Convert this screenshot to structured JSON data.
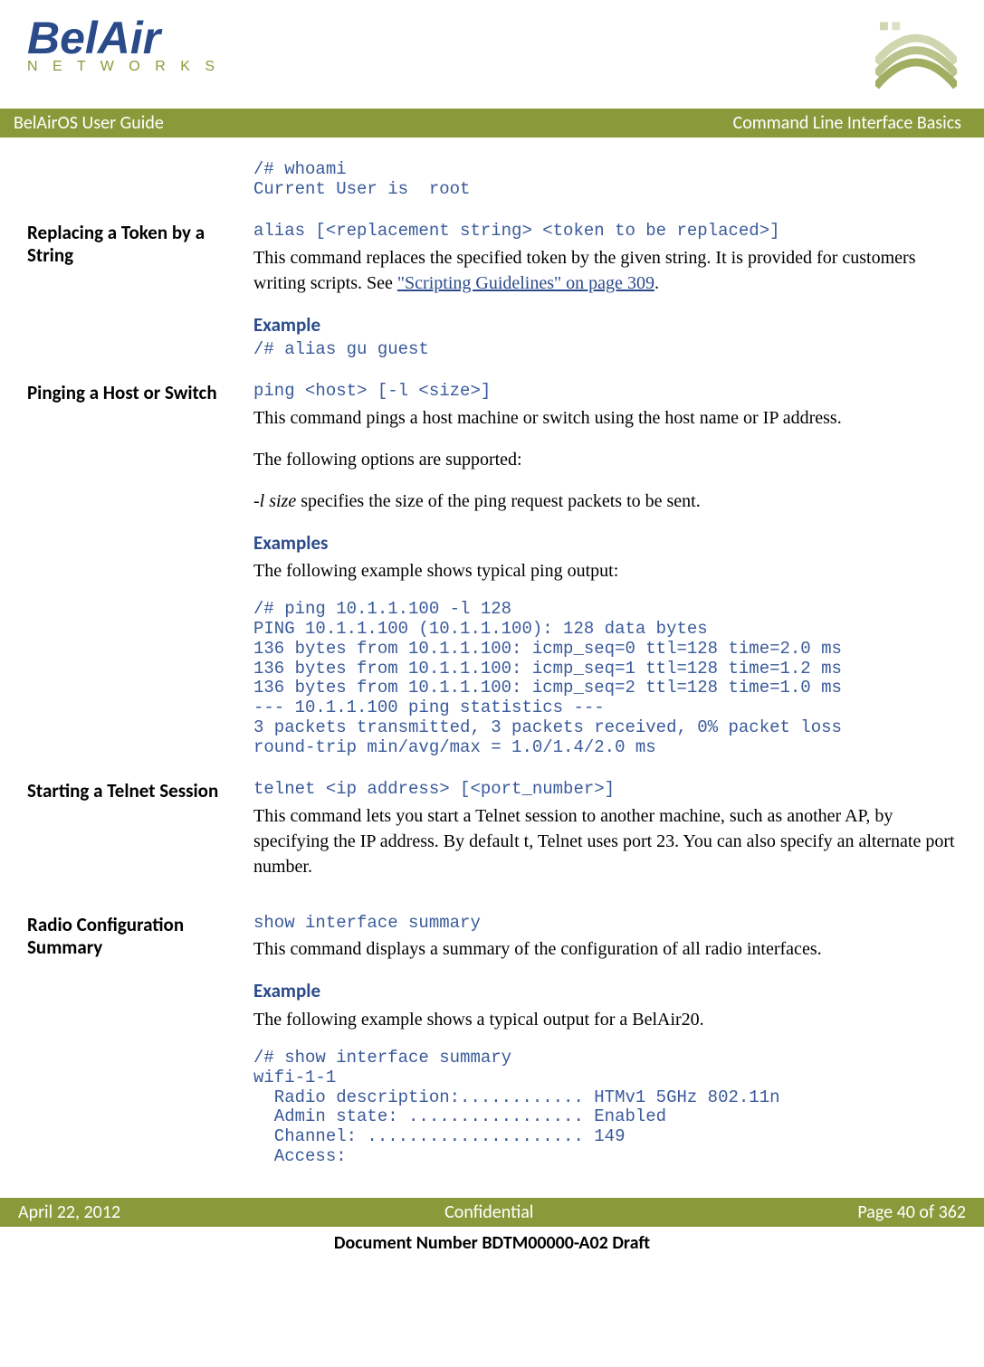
{
  "logo": {
    "main": "BelAir",
    "sub": "N E T W O R K S"
  },
  "header": {
    "left": "BelAirOS User Guide",
    "right": "Command Line Interface Basics"
  },
  "intro_code": "/# whoami\nCurrent User is  root",
  "sections": {
    "replacing": {
      "heading": "Replacing a Token by a String",
      "syntax": "alias [<replacement string> <token to be replaced>]",
      "desc_a": "This command replaces the specified token by the given string. It is provided for customers writing scripts. See ",
      "link": "\"Scripting Guidelines\" on page 309",
      "desc_b": ".",
      "example_head": "Example",
      "example_code": "/# alias gu guest"
    },
    "pinging": {
      "heading": "Pinging a Host or Switch",
      "syntax": "ping <host> [-l <size>]",
      "desc1": "This command pings a host machine or switch using the host name or IP address.",
      "desc2": "The following options are supported:",
      "opt_italic": "-l size",
      "opt_rest": " specifies the size of the ping request packets to be sent.",
      "examples_head": "Examples",
      "examples_intro": "The following example shows typical ping output:",
      "examples_code": "/# ping 10.1.1.100 -l 128\nPING 10.1.1.100 (10.1.1.100): 128 data bytes\n136 bytes from 10.1.1.100: icmp_seq=0 ttl=128 time=2.0 ms\n136 bytes from 10.1.1.100: icmp_seq=1 ttl=128 time=1.2 ms\n136 bytes from 10.1.1.100: icmp_seq=2 ttl=128 time=1.0 ms\n--- 10.1.1.100 ping statistics ---\n3 packets transmitted, 3 packets received, 0% packet loss\nround-trip min/avg/max = 1.0/1.4/2.0 ms"
    },
    "telnet": {
      "heading": "Starting a Telnet Session",
      "syntax": "telnet <ip address> [<port_number>]",
      "desc": "This command lets you start a Telnet session to another machine, such as another AP, by specifying the IP address. By default t, Telnet uses port 23. You can also specify an alternate port number."
    },
    "radio": {
      "heading": "Radio Configuration Summary",
      "syntax": "show interface summary",
      "desc": "This command displays a summary of the configuration of all radio interfaces.",
      "example_head": "Example",
      "example_intro": "The following example shows a typical output for a BelAir20.",
      "example_code": "/# show interface summary\nwifi-1-1\n  Radio description:............ HTMv1 5GHz 802.11n\n  Admin state: ................. Enabled\n  Channel: ..................... 149\n  Access:"
    }
  },
  "footer": {
    "left": "April 22, 2012",
    "center": "Confidential",
    "right": "Page 40 of 362",
    "docnum": "Document Number BDTM00000-A02 Draft"
  }
}
